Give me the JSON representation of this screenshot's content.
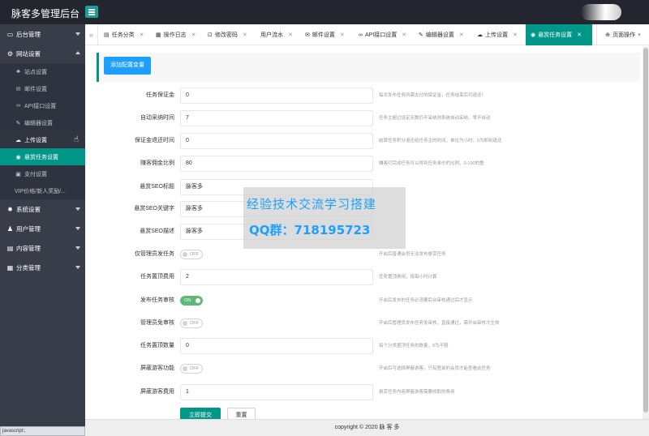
{
  "header": {
    "title": "脉客多管理后台"
  },
  "sidebar": {
    "groups": [
      {
        "label": "后台管理",
        "icon": "monitor-icon"
      },
      {
        "label": "网站设置",
        "icon": "settings-icon"
      },
      {
        "label": "系统设置",
        "icon": "gear-icon"
      },
      {
        "label": "用户管理",
        "icon": "user-icon"
      },
      {
        "label": "内容管理",
        "icon": "file-icon"
      },
      {
        "label": "分类管理",
        "icon": "grid-icon"
      }
    ],
    "sub_items": [
      {
        "label": "站点设置",
        "icon": "site-icon"
      },
      {
        "label": "邮件设置",
        "icon": "mail-icon"
      },
      {
        "label": "API接口设置",
        "icon": "link-icon"
      },
      {
        "label": "编辑器设置",
        "icon": "edit-icon"
      },
      {
        "label": "上传设置",
        "icon": "cloud-icon"
      },
      {
        "label": "悬赏任务设置",
        "icon": "reward-icon"
      },
      {
        "label": "支付设置",
        "icon": "wallet-icon"
      },
      {
        "label": "VIP价格/新人奖励/...",
        "icon": ""
      }
    ]
  },
  "tabs": [
    {
      "label": "任务分类",
      "icon": "file-icon"
    },
    {
      "label": "操作日志",
      "icon": "log-icon"
    },
    {
      "label": "修改密码",
      "icon": "lock-icon"
    },
    {
      "label": "用户流水",
      "icon": ""
    },
    {
      "label": "邮件设置",
      "icon": "mail-icon"
    },
    {
      "label": "API接口设置",
      "icon": "link-icon"
    },
    {
      "label": "编辑器设置",
      "icon": "edit-icon"
    },
    {
      "label": "上传设置",
      "icon": "cloud-icon"
    },
    {
      "label": "悬赏任务设置",
      "icon": "reward-icon"
    }
  ],
  "page_actions": {
    "label": "页面操作"
  },
  "toolbar": {
    "add_label": "添加配置变量"
  },
  "form": {
    "rows": [
      {
        "label": "任务保证金",
        "type": "input",
        "value": "0",
        "tip": "每次发布任务所需支付的保证金，任务结束后可退还!"
      },
      {
        "label": "自动采纳时间",
        "type": "input",
        "value": "7",
        "tip": "任务主超过设定天数仍不采纳则系统自动采纳，零不自动"
      },
      {
        "label": "保证金退还时间",
        "type": "input",
        "value": "0",
        "tip": "结算任务积分退还给任务主的时间，单位为小时，0为即刻退还"
      },
      {
        "label": "赚客佣金比例",
        "type": "input",
        "value": "80",
        "tip": "赚客们完成任务可以得到任务单价的比例，0-100的整"
      },
      {
        "label": "悬赏SEO标题",
        "type": "input",
        "value": "脉客多",
        "tip": ""
      },
      {
        "label": "悬赏SEO关键字",
        "type": "input",
        "value": "脉客多",
        "tip": ""
      },
      {
        "label": "悬赏SEO描述",
        "type": "input",
        "value": "脉客多",
        "tip": ""
      },
      {
        "label": "仅管理员发任务",
        "type": "switch",
        "on": false,
        "switch_text": "OFF",
        "tip": "开启后普通会员无法发布悬赏任务"
      },
      {
        "label": "任务置顶费用",
        "type": "input",
        "value": "2",
        "tip": "任务置顶费用，按每小时计算"
      },
      {
        "label": "发布任务审核",
        "type": "switch",
        "on": true,
        "switch_text": "ON",
        "tip": "开启后发布的任务必须要后台审核通过后才显示"
      },
      {
        "label": "管理员免审核",
        "type": "switch",
        "on": false,
        "switch_text": "OFF",
        "tip": "开启后管理员发布任务免审核，直接通过，需开启审核才生效"
      },
      {
        "label": "任务置顶数量",
        "type": "input",
        "value": "0",
        "tip": "每个分类置顶任务的数量，0为不限"
      },
      {
        "label": "屏蔽游客功能",
        "type": "switch",
        "on": false,
        "switch_text": "OFF",
        "tip": "开启后可选择屏蔽游客，只有登录的会员才能查看此任务"
      },
      {
        "label": "屏蔽游客费用",
        "type": "input",
        "value": "1",
        "tip": "悬赏任务内容屏蔽游客需要收取的费用"
      }
    ],
    "submit_label": "立即提交",
    "reset_label": "重置"
  },
  "watermark": {
    "line1": "经验技术交流学习搭建",
    "line2": "QQ群：718195723"
  },
  "footer": {
    "copyright": "copyright © 2020 脉 客 多"
  },
  "statusbar": {
    "text": "javascript:;"
  },
  "colors": {
    "accent": "#009688",
    "sidebar": "#393d49",
    "topbar": "#23262e",
    "primary_button": "#1e9fff",
    "switch_on": "#5fb878"
  }
}
